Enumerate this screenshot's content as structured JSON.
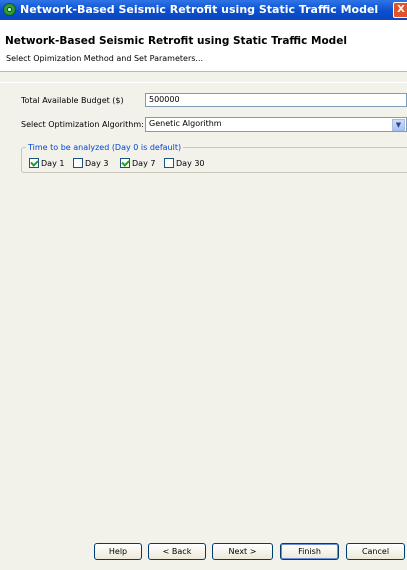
{
  "window": {
    "title": "Network-Based Seismic Retrofit using Static Traffic Model",
    "close_glyph": "X",
    "app_icon": "app-logo-icon"
  },
  "header": {
    "heading": "Network-Based Seismic Retrofit using Static Traffic Model",
    "subheading": "Select Opimization Method and Set Parameters..."
  },
  "form": {
    "budget_label": "Total Available Budget ($)",
    "budget_value": "500000",
    "algorithm_label": "Select Optimization Algorithm:",
    "algorithm_value": "Genetic Algorithm",
    "dropdown_glyph": "▼",
    "time_group_title": "Time to be analyzed (Day 0 is default)",
    "days": [
      {
        "label": "Day 1",
        "checked": true
      },
      {
        "label": "Day 3",
        "checked": false
      },
      {
        "label": "Day 7",
        "checked": true
      },
      {
        "label": "Day 30",
        "checked": false
      }
    ]
  },
  "buttons": {
    "help": "Help",
    "back": "< Back",
    "next": "Next >",
    "finish": "Finish",
    "cancel": "Cancel"
  },
  "colors": {
    "titlebar": "#0a4fd0",
    "dialog_bg": "#f2f1ea",
    "group_title": "#0046d5",
    "check_mark": "#21a121"
  }
}
